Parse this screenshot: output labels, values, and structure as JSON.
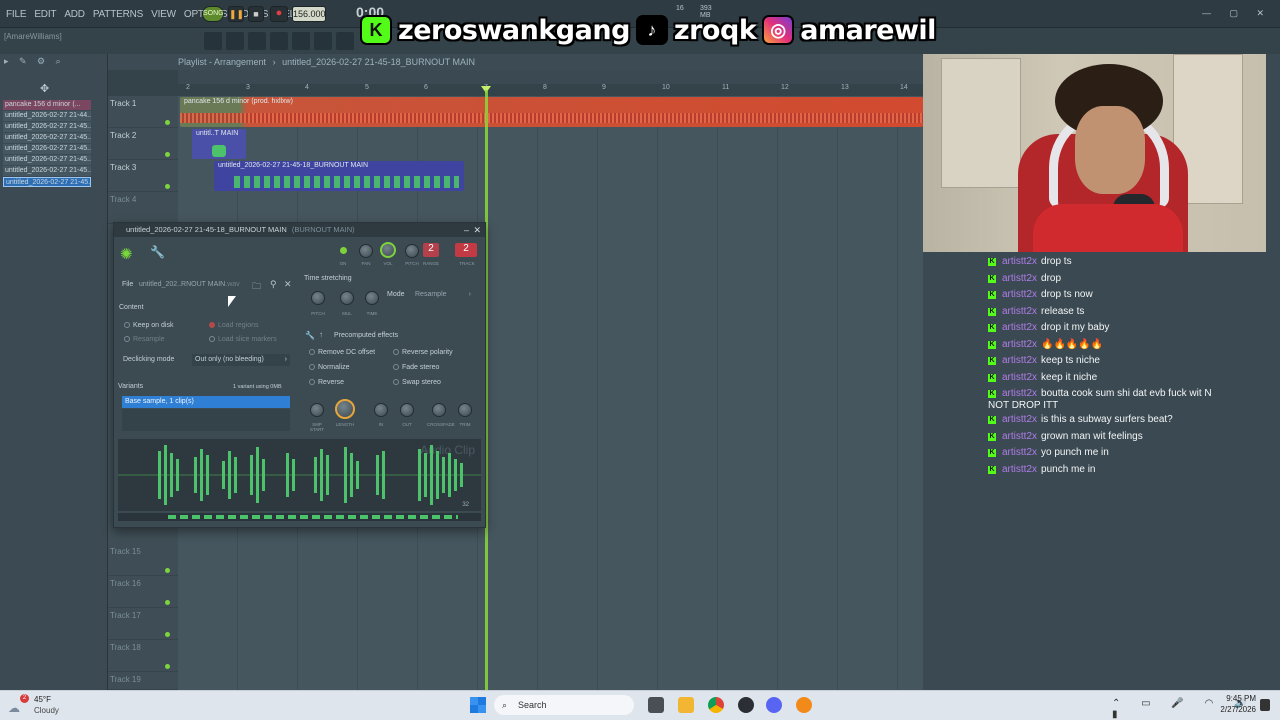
{
  "menubar": {
    "items": [
      "FILE",
      "EDIT",
      "ADD",
      "PATTERNS",
      "VIEW",
      "OPTIONS",
      "TOOLS",
      "HELP"
    ],
    "song_label": "SONG",
    "tempo": "156.000",
    "time": "0:00",
    "time_small": "M:S:CS",
    "cpu": "16",
    "memory": "393 MB",
    "window_controls": "— ▢ ✕"
  },
  "overlay": {
    "kick_name": "zeroswankgang",
    "tiktok_name": "zroqk",
    "instagram_name": "amarewil"
  },
  "user_label": "[AmareWilliams]",
  "browser": {
    "items": [
      "pancake 156 d minor (...",
      "untitled_2026-02-27 21-44...",
      "untitled_2026-02-27 21-45...",
      "untitled_2026-02-27 21-45...",
      "untitled_2026-02-27 21-45...",
      "untitled_2026-02-27 21-45...",
      "untitled_2026-02-27 21-45...",
      "untitled_2026-02-27 21-45..."
    ]
  },
  "playlist": {
    "title": "Playlist - Arrangement",
    "pattern": "untitled_2026-02-27 21-45-18_BURNOUT MAIN",
    "ruler": [
      "2",
      "3",
      "4",
      "5",
      "6",
      "7",
      "8",
      "9",
      "10",
      "11",
      "12",
      "13",
      "14"
    ],
    "tracks_top": [
      "Track 1",
      "Track 2",
      "Track 3",
      "Track 4"
    ],
    "tracks_bottom": [
      "Track 15",
      "Track 16",
      "Track 17",
      "Track 18",
      "Track 19"
    ],
    "clips": {
      "clip1": "pancake 156 d minor (prod. hxllxw)",
      "clip2": "untitl..T MAIN",
      "clip3": "untitled_2026-02-27 21-45-18_BURNOUT MAIN"
    }
  },
  "sampler": {
    "title": "untitled_2026-02-27 21-45-18_BURNOUT MAIN",
    "title_sub": "(BURNOUT MAIN)",
    "top_knobs": [
      "ON",
      "PAN",
      "VOL",
      "PITCH",
      "RANGE",
      "TRACK"
    ],
    "range_value": "2",
    "track_value": "2",
    "file_label": "File",
    "file_value": "untitled_202..RNOUT MAIN",
    "file_ext": ".wav",
    "content_label": "Content",
    "keep_on_disk": "Keep on disk",
    "load_regions": "Load regions",
    "resample": "Resample",
    "load_slice_markers": "Load slice markers",
    "declicking_label": "Declicking mode",
    "declicking_value": "Out only (no bleeding)",
    "variants_label": "Variants",
    "variants_info": "1 variant using 0MB",
    "variant_item": "Base sample, 1 clip(s)",
    "time_stretching": "Time stretching",
    "ts_knobs": [
      "PITCH",
      "MUL",
      "TIME"
    ],
    "mode_label": "Mode",
    "mode_value": "Resample",
    "precomputed": "Precomputed effects",
    "fx_left": [
      "Remove DC offset",
      "Normalize",
      "Reverse"
    ],
    "fx_right": [
      "Reverse polarity",
      "Fade stereo",
      "Swap stereo"
    ],
    "fx_knobs": [
      "SMP START",
      "LENGTH",
      "IN",
      "OUT",
      "CROSSFADE",
      "TRIM"
    ],
    "watermark": "Audio Clip",
    "wave_counter": "32"
  },
  "chat": [
    {
      "user": "artistt2x",
      "msg": "drop ts"
    },
    {
      "user": "artistt2x",
      "msg": "drop"
    },
    {
      "user": "artistt2x",
      "msg": "drop ts now"
    },
    {
      "user": "artistt2x",
      "msg": "release ts"
    },
    {
      "user": "artistt2x",
      "msg": "drop it my baby"
    },
    {
      "user": "artistt2x",
      "msg": "🔥🔥🔥🔥🔥"
    },
    {
      "user": "artistt2x",
      "msg": "keep ts niche"
    },
    {
      "user": "artistt2x",
      "msg": "keep it niche"
    },
    {
      "user": "artistt2x",
      "msg": "boutta cook sum shi dat evb fuck wit N",
      "msg2": "NOT DROP ITT"
    },
    {
      "user": "artistt2x",
      "msg": "is this a subway surfers beat?"
    },
    {
      "user": "artistt2x",
      "msg": "grown man wit feelings"
    },
    {
      "user": "artistt2x",
      "msg": "yo punch me in"
    },
    {
      "user": "artistt2x",
      "msg": "punch me in"
    }
  ],
  "taskbar": {
    "weather_temp": "45°F",
    "weather_desc": "Cloudy",
    "weather_badge": "2",
    "search": "Search",
    "time": "9:45 PM",
    "date": "2/27/2026"
  },
  "colors": {
    "accent_green": "#7ed23c",
    "chat_user": "#b07ce8",
    "kick_green": "#53fc18",
    "variant_selected": "#2f7fd4"
  }
}
